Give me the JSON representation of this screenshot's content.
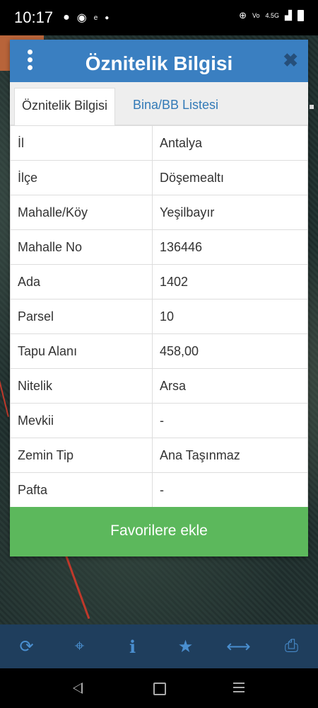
{
  "status_bar": {
    "time": "10:17",
    "left_icons": [
      "chat-icon",
      "whatsapp-icon",
      "emlak-icon",
      "dot-icon"
    ],
    "right_icons": [
      "data-saver-icon",
      "volte-icon",
      "signal-icon",
      "battery-icon"
    ],
    "network_label": "4.5G"
  },
  "dialog": {
    "title": "Öznitelik Bilgisi",
    "tabs": [
      {
        "label": "Öznitelik Bilgisi",
        "active": true
      },
      {
        "label": "Bina/BB Listesi",
        "active": false
      }
    ],
    "rows": [
      {
        "key": "İl",
        "value": "Antalya"
      },
      {
        "key": "İlçe",
        "value": "Döşemealtı"
      },
      {
        "key": "Mahalle/Köy",
        "value": "Yeşilbayır"
      },
      {
        "key": "Mahalle No",
        "value": "136446"
      },
      {
        "key": "Ada",
        "value": "1402"
      },
      {
        "key": "Parsel",
        "value": "10"
      },
      {
        "key": "Tapu Alanı",
        "value": "458,00"
      },
      {
        "key": "Nitelik",
        "value": "Arsa"
      },
      {
        "key": "Mevkii",
        "value": "-"
      },
      {
        "key": "Zemin Tip",
        "value": "Ana Taşınmaz"
      },
      {
        "key": "Pafta",
        "value": "-"
      }
    ],
    "favorite_button": "Favorilere ekle",
    "close_symbol": "✖"
  },
  "toolbar": {
    "items": [
      "refresh-icon",
      "locate-icon",
      "info-icon",
      "star-icon",
      "measure-icon",
      "print-icon"
    ]
  },
  "colors": {
    "header": "#3a7fc1",
    "button_green": "#5cb85c",
    "toolbar_bg": "#1f3e5d",
    "toolbar_icon": "#4a8fd0",
    "tab_link": "#337ab7"
  }
}
